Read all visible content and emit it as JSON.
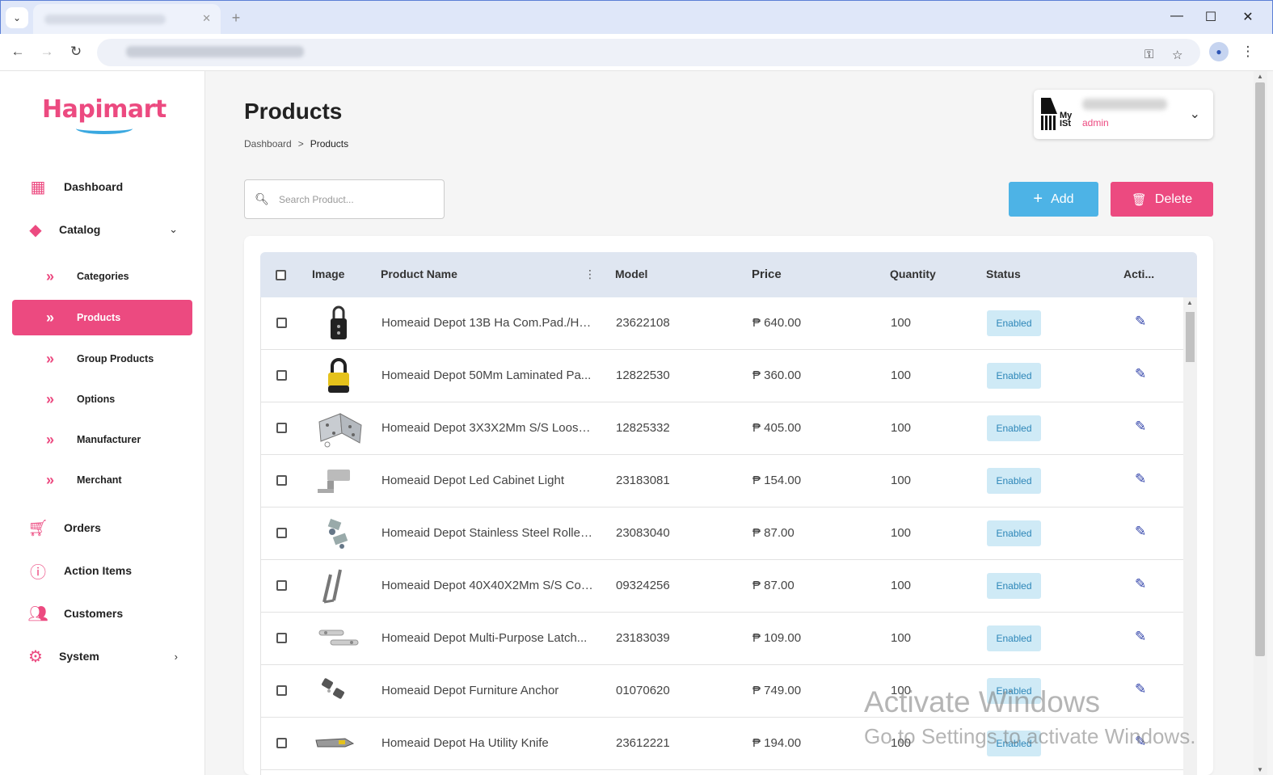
{
  "browser": {
    "tab_close": "✕",
    "new_tab": "+",
    "window_controls": [
      "—",
      "☐",
      "✕"
    ]
  },
  "sidebar": {
    "logo": "Hapimart",
    "items": [
      {
        "label": "Dashboard",
        "icon": "dashboard-icon"
      },
      {
        "label": "Catalog",
        "icon": "tag-icon",
        "caret": "chevron-down-icon"
      },
      {
        "label": "Orders",
        "icon": "cart-icon"
      },
      {
        "label": "Action Items",
        "icon": "info-icon"
      },
      {
        "label": "Customers",
        "icon": "people-icon"
      },
      {
        "label": "System",
        "icon": "gear-icon",
        "caret": "chevron-right-icon"
      }
    ],
    "catalog_sub": [
      {
        "label": "Categories"
      },
      {
        "label": "Products",
        "active": true
      },
      {
        "label": "Group Products"
      },
      {
        "label": "Options"
      },
      {
        "label": "Manufacturer"
      },
      {
        "label": "Merchant"
      }
    ]
  },
  "header": {
    "title": "Products",
    "breadcrumb": [
      "Dashboard",
      ">",
      "Products"
    ]
  },
  "user": {
    "badge_text": "My ISt",
    "role": "admin"
  },
  "toolbar": {
    "search_placeholder": "Search Product...",
    "add_label": "Add",
    "delete_label": "Delete"
  },
  "table": {
    "columns": [
      "Image",
      "Product Name",
      "Model",
      "Price",
      "Quantity",
      "Status",
      "Acti..."
    ],
    "rows": [
      {
        "name": "Homeaid Depot 13B Ha Com.Pad./Hd...",
        "model": "23622108",
        "price": "₱ 640.00",
        "qty": "100",
        "status": "Enabled",
        "image": "padlock-combo"
      },
      {
        "name": "Homeaid Depot 50Mm Laminated Pa...",
        "model": "12822530",
        "price": "₱ 360.00",
        "qty": "100",
        "status": "Enabled",
        "image": "padlock-yellow"
      },
      {
        "name": "Homeaid Depot 3X3X2Mm S/S Loose ...",
        "model": "12825332",
        "price": "₱ 405.00",
        "qty": "100",
        "status": "Enabled",
        "image": "hinge"
      },
      {
        "name": "Homeaid Depot Led Cabinet Light",
        "model": "23183081",
        "price": "₱ 154.00",
        "qty": "100",
        "status": "Enabled",
        "image": "cabinet-light"
      },
      {
        "name": "Homeaid Depot Stainless Steel Roller ...",
        "model": "23083040",
        "price": "₱ 87.00",
        "qty": "100",
        "status": "Enabled",
        "image": "roller-catch"
      },
      {
        "name": "Homeaid Depot 40X40X2Mm S/S Cor...",
        "model": "09324256",
        "price": "₱ 87.00",
        "qty": "100",
        "status": "Enabled",
        "image": "corner-brace"
      },
      {
        "name": "Homeaid Depot Multi-Purpose Latch...",
        "model": "23183039",
        "price": "₱ 109.00",
        "qty": "100",
        "status": "Enabled",
        "image": "latch"
      },
      {
        "name": "Homeaid Depot Furniture Anchor",
        "model": "01070620",
        "price": "₱ 749.00",
        "qty": "100",
        "status": "Enabled",
        "image": "anchor"
      },
      {
        "name": "Homeaid Depot Ha Utility Knife",
        "model": "23612221",
        "price": "₱ 194.00",
        "qty": "100",
        "status": "Enabled",
        "image": "utility-knife"
      }
    ]
  },
  "watermark": {
    "line1": "Activate Windows",
    "line2": "Go to Settings to activate Windows."
  },
  "colors": {
    "accent": "#ec4a80",
    "add_button": "#4db3e6",
    "status_badge_bg": "#cfeaf6",
    "edit_icon": "#2d3fa8"
  }
}
